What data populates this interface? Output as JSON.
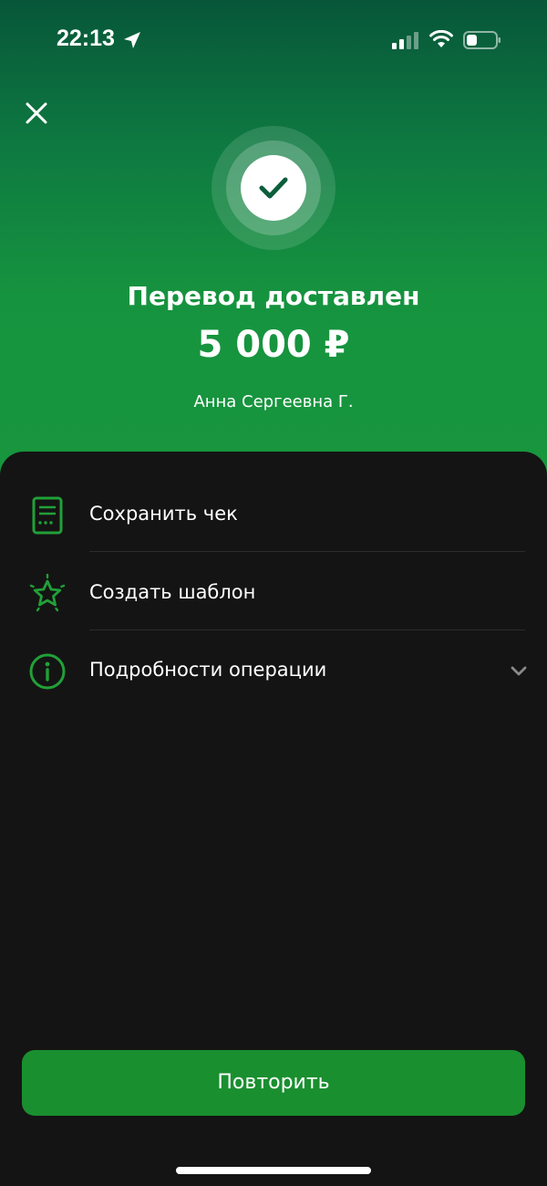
{
  "status_bar": {
    "time": "22:13"
  },
  "result": {
    "title": "Перевод доставлен",
    "amount": "5 000 ₽",
    "recipient": "Анна Сергеевна Г."
  },
  "actions": [
    {
      "label": "Сохранить чек",
      "icon": "receipt-icon"
    },
    {
      "label": "Создать шаблон",
      "icon": "star-icon"
    },
    {
      "label": "Подробности операции",
      "icon": "info-icon"
    }
  ],
  "repeat_button": {
    "label": "Повторить"
  },
  "colors": {
    "accent": "#1a8f2f",
    "icon_green": "#21a038",
    "hero_top": "#075639",
    "hero_bottom": "#18963d",
    "background": "#141414"
  }
}
